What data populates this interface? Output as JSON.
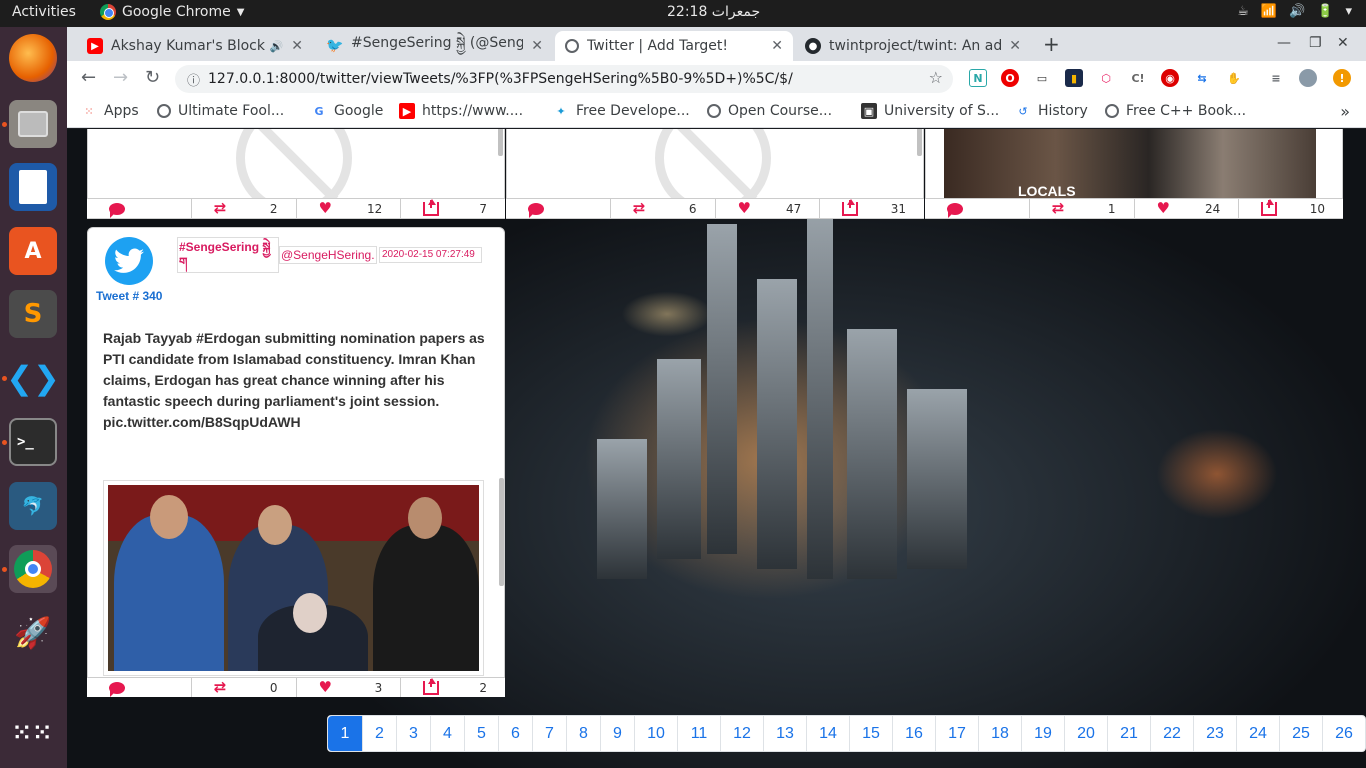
{
  "topbar": {
    "activities": "Activities",
    "app_name": "Google Chrome",
    "clock": "جمعرات 22:18"
  },
  "tabs": [
    {
      "title": "Akshay Kumar's Block",
      "favicon": "youtube-icon",
      "sound": true
    },
    {
      "title": "#SengeSering སྐྱེ (@Seng",
      "favicon": "twitter-icon"
    },
    {
      "title": "Twitter | Add Target!",
      "favicon": "globe-icon",
      "active": true
    },
    {
      "title": "twintproject/twint: An ad",
      "favicon": "github-icon"
    }
  ],
  "address": {
    "url": "127.0.0.1:8000/twitter/viewTweets/%3FP(%3FPSengeHSering%5B0-9%5D+)%5C/$/"
  },
  "bookmarks": [
    {
      "label": "Apps",
      "icon": "apps-grid-icon"
    },
    {
      "label": "Ultimate Fool...",
      "icon": "globe-icon"
    },
    {
      "label": "Google",
      "icon": "google-icon"
    },
    {
      "label": "https://www....",
      "icon": "youtube-icon"
    },
    {
      "label": "Free Develope...",
      "icon": "bookmark-icon"
    },
    {
      "label": "Open Course...",
      "icon": "globe-icon"
    },
    {
      "label": "University of S...",
      "icon": "university-icon"
    },
    {
      "label": "History",
      "icon": "history-icon"
    },
    {
      "label": "Free C++ Book...",
      "icon": "globe-icon"
    }
  ],
  "top_cards": [
    {
      "replies": "",
      "retweets": "2",
      "likes": "12",
      "shares": "7"
    },
    {
      "replies": "",
      "retweets": "6",
      "likes": "47",
      "shares": "31"
    },
    {
      "replies": "",
      "retweets": "1",
      "likes": "24",
      "shares": "10",
      "image_caption": "LOCALS"
    }
  ],
  "tweet": {
    "number_label": "Tweet # 340",
    "hashtag": "#SengeSering སྐྱེ ག",
    "username": "@SengeHSering.",
    "date": "2020-02-15 07:27:49",
    "text": "Rajab Tayyab #Erdogan submitting nomination papers as PTI candidate from Islamabad constituency. Imran Khan claims, Erdogan has great chance winning after his fantastic speech during parliament's joint session. pic.twitter.com/B8SqpUdAWH",
    "retweets": "0",
    "likes": "3",
    "shares": "2"
  },
  "pagination": {
    "active": "1",
    "pages": [
      "1",
      "2",
      "3",
      "4",
      "5",
      "6",
      "7",
      "8",
      "9",
      "10",
      "11",
      "12",
      "13",
      "14",
      "15",
      "16",
      "17",
      "18",
      "19",
      "20",
      "21",
      "22",
      "23",
      "24",
      "25",
      "26"
    ]
  },
  "colors": {
    "accent_pink": "#e6184f",
    "link_blue": "#1a73e8",
    "twitter_blue": "#1da1f2"
  }
}
